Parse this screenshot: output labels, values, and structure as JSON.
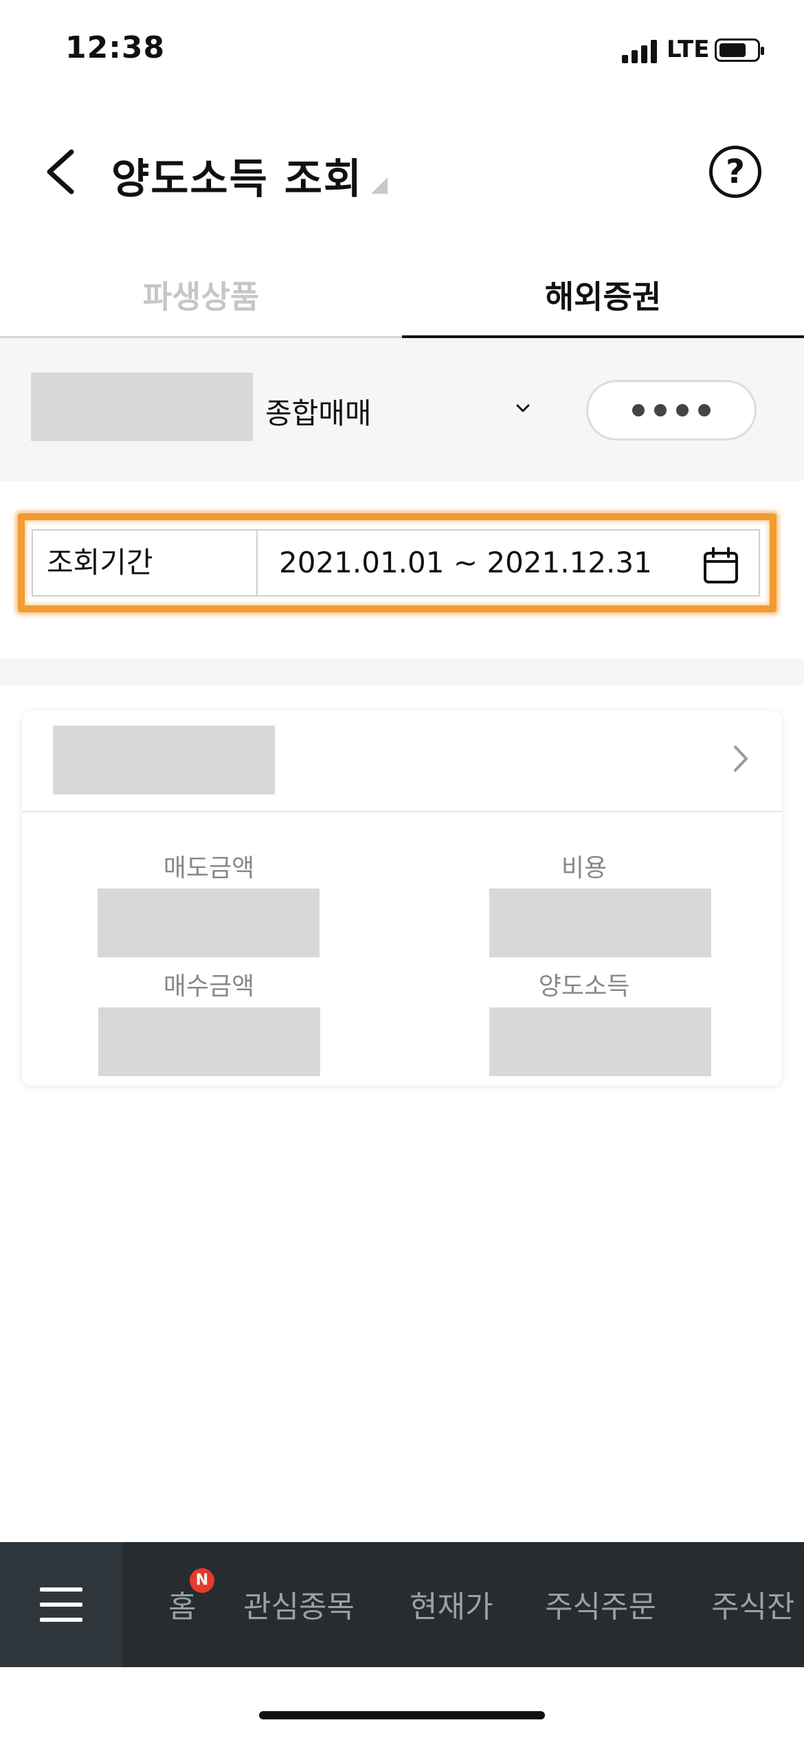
{
  "status_bar": {
    "time": "12:38",
    "network": "LTE"
  },
  "header": {
    "title": "양도소득 조회"
  },
  "tabs": [
    {
      "label": "파생상품",
      "active": false
    },
    {
      "label": "해외증권",
      "active": true
    }
  ],
  "account": {
    "type": "종합매매",
    "password_mask": "●●●●"
  },
  "query": {
    "label": "조회기간",
    "range": "2021.01.01 ~ 2021.12.31"
  },
  "summary": {
    "sell_label": "매도금액",
    "cost_label": "비용",
    "buy_label": "매수금액",
    "gain_label": "양도소득"
  },
  "bottom_nav": {
    "badge": "N",
    "items": [
      "홈",
      "관심종목",
      "현재가",
      "주식주문",
      "주식잔"
    ]
  },
  "colors": {
    "highlight": "#f19b32",
    "nav_bg": "#262c30",
    "badge": "#e33a2e"
  }
}
